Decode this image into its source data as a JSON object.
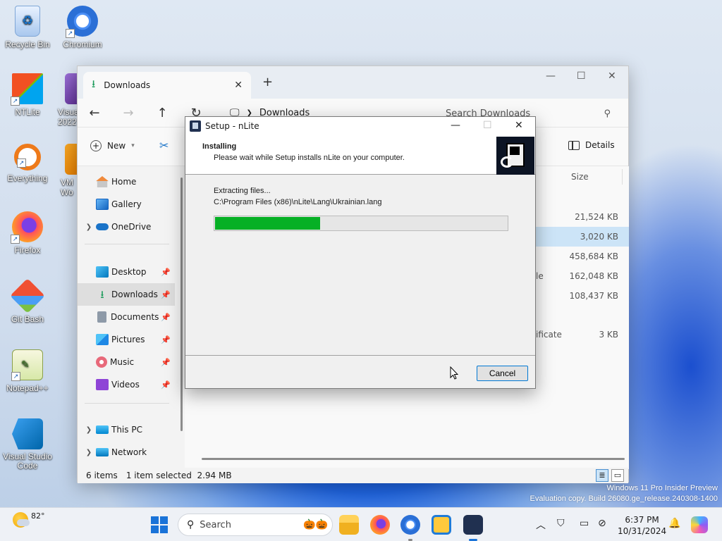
{
  "desktop": {
    "icons": [
      {
        "label": "Recycle Bin",
        "icon": "recycle-bin-icon"
      },
      {
        "label": "Chromium",
        "icon": "chromium-icon"
      },
      {
        "label": "NTLite",
        "icon": "ntlite-icon"
      },
      {
        "label": "Visua 2022",
        "icon": "visual-studio-icon"
      },
      {
        "label": "Everything",
        "icon": "everything-icon"
      },
      {
        "label": "VM Wo",
        "icon": "vmware-icon"
      },
      {
        "label": "Firefox",
        "icon": "firefox-icon"
      },
      {
        "label": "Git Bash",
        "icon": "git-bash-icon"
      },
      {
        "label": "Notepad++",
        "icon": "notepad-plus-plus-icon"
      },
      {
        "label": "Visual Studio Code",
        "icon": "vscode-icon"
      }
    ]
  },
  "explorer": {
    "tab_title": "Downloads",
    "breadcrumb": "Downloads",
    "search_placeholder": "Search Downloads",
    "new_label": "New",
    "details_label": "Details",
    "sidebar": [
      {
        "label": "Home",
        "icon": "home-icon"
      },
      {
        "label": "Gallery",
        "icon": "gallery-icon"
      },
      {
        "label": "OneDrive",
        "icon": "onedrive-icon"
      },
      {
        "label": "Desktop",
        "icon": "desktop-icon"
      },
      {
        "label": "Downloads",
        "icon": "downloads-icon"
      },
      {
        "label": "Documents",
        "icon": "documents-icon"
      },
      {
        "label": "Pictures",
        "icon": "pictures-icon"
      },
      {
        "label": "Music",
        "icon": "music-icon"
      },
      {
        "label": "Videos",
        "icon": "videos-icon"
      },
      {
        "label": "This PC",
        "icon": "this-pc-icon"
      },
      {
        "label": "Network",
        "icon": "network-icon"
      }
    ],
    "column_size": "Size",
    "files": [
      {
        "name_fragment": "",
        "size": "21,524 KB"
      },
      {
        "name_fragment": "",
        "size": "3,020 KB"
      },
      {
        "name_fragment": "",
        "size": "458,684 KB"
      },
      {
        "name_fragment": "le",
        "size": "162,048 KB"
      },
      {
        "name_fragment": "",
        "size": "108,437 KB"
      },
      {
        "name_fragment": "ificate",
        "size": "3 KB"
      }
    ],
    "status_items": "6 items",
    "status_selected": "1 item selected  2.94 MB"
  },
  "dialog": {
    "title": "Setup - nLite",
    "header_title": "Installing",
    "header_subtitle": "Please wait while Setup installs nLite on your computer.",
    "status_line1": "Extracting files...",
    "status_line2": "C:\\Program Files (x86)\\nLite\\Lang\\Ukrainian.lang",
    "progress_percent": 36,
    "cancel_label": "Cancel"
  },
  "watermark": {
    "line1": "Windows 11 Pro Insider Preview",
    "line2": "Evaluation copy. Build 26080.ge_release.240308-1400"
  },
  "taskbar": {
    "temperature": "82°",
    "search_placeholder": "Search",
    "time": "6:37 PM",
    "date": "10/31/2024"
  },
  "colors": {
    "progress_fill": "#06b025",
    "accent": "#0078d4"
  }
}
